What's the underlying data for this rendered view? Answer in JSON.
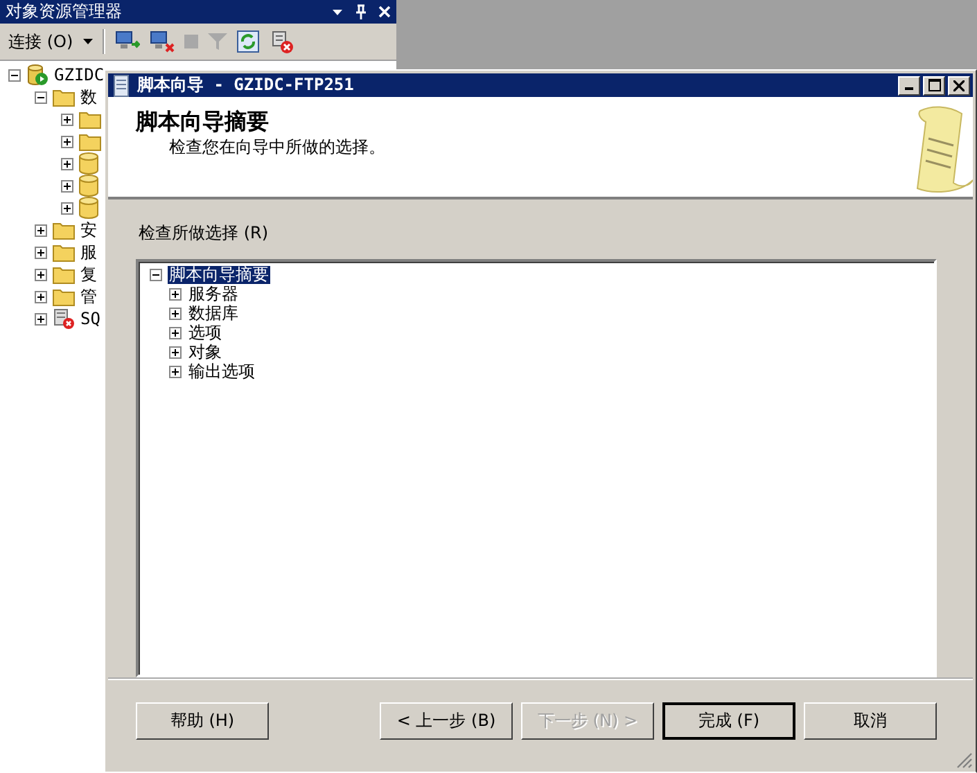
{
  "explorer": {
    "title": "对象资源管理器",
    "connect_label": "连接 (O)",
    "tree": [
      {
        "label": "GZIDC",
        "kind": "server",
        "expanded": true,
        "children": [
          {
            "label": "数",
            "kind": "folder",
            "expanded": true,
            "children": [
              {
                "kind": "folder",
                "expanded": false
              },
              {
                "kind": "folder",
                "expanded": false
              },
              {
                "kind": "database",
                "expanded": false
              },
              {
                "kind": "database",
                "expanded": false
              },
              {
                "kind": "database",
                "expanded": false
              }
            ]
          },
          {
            "label": "安",
            "kind": "folder",
            "expanded": false
          },
          {
            "label": "服",
            "kind": "folder",
            "expanded": false
          },
          {
            "label": "复",
            "kind": "folder",
            "expanded": false
          },
          {
            "label": "管",
            "kind": "folder",
            "expanded": false
          },
          {
            "label": "SQ",
            "kind": "agent",
            "expanded": false
          }
        ]
      }
    ]
  },
  "dialog": {
    "title": "脚本向导 - GZIDC-FTP251",
    "heading": "脚本向导摘要",
    "subheading": "检查您在向导中所做的选择。",
    "review_label": "检查所做选择 (R)",
    "tree": [
      {
        "label": "脚本向导摘要",
        "selected": true,
        "expanded": true,
        "children": [
          {
            "label": "服务器",
            "selected": false,
            "expanded": false
          },
          {
            "label": "数据库",
            "selected": false,
            "expanded": false
          },
          {
            "label": "选项",
            "selected": false,
            "expanded": false
          },
          {
            "label": "对象",
            "selected": false,
            "expanded": false
          },
          {
            "label": "输出选项",
            "selected": false,
            "expanded": false
          }
        ]
      }
    ],
    "buttons": [
      {
        "label": "帮助 (H)",
        "kind": "help",
        "disabled": false,
        "default": false
      },
      {
        "label": "< 上一步 (B)",
        "kind": "nav",
        "disabled": false,
        "default": false
      },
      {
        "label": "下一步 (N) >",
        "kind": "nav",
        "disabled": true,
        "default": false
      },
      {
        "label": "完成 (F)",
        "kind": "nav",
        "disabled": false,
        "default": true
      },
      {
        "label": "取消",
        "kind": "nav",
        "disabled": false,
        "default": false
      }
    ]
  }
}
